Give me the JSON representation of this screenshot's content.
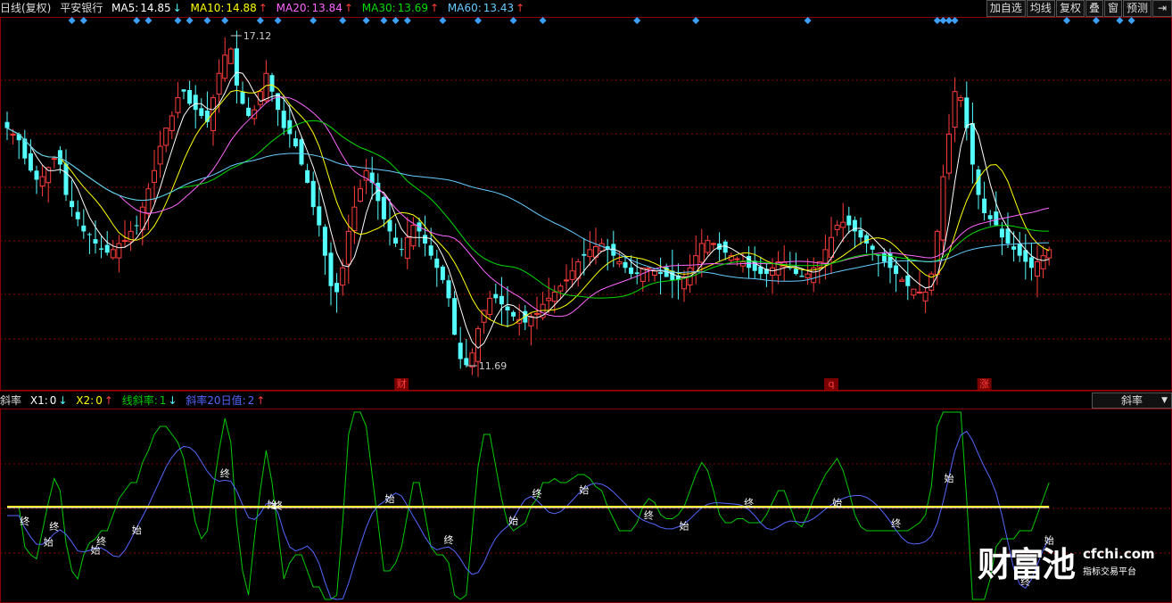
{
  "header": {
    "period": "日线(复权)",
    "stock_name": "平安银行",
    "ma5": {
      "label": "MA5:",
      "value": "14.85",
      "arrow": "↓",
      "color": "#ffffff"
    },
    "ma10": {
      "label": "MA10:",
      "value": "14.88",
      "arrow": "↑",
      "color": "#ffff00"
    },
    "ma20": {
      "label": "MA20:",
      "value": "13.84",
      "arrow": "↑",
      "color": "#ff66ff"
    },
    "ma30": {
      "label": "MA30:",
      "value": "13.69",
      "arrow": "↑",
      "color": "#00dd00"
    },
    "ma60": {
      "label": "MA60:",
      "value": "13.43",
      "arrow": "↑",
      "color": "#66ccff"
    }
  },
  "toolbar": {
    "add_watchlist": "加自选",
    "ma_lines": "均线",
    "adjust": "复权",
    "overlay": "叠",
    "window": "窗",
    "forecast": "预测",
    "expand_icon": "expand-right-icon"
  },
  "annotations": {
    "high_label": "17.12",
    "low_label": "11.69",
    "event_markers": [
      {
        "text": "财",
        "idx": 67
      },
      {
        "text": "q",
        "idx": 140
      },
      {
        "text": "涨",
        "idx": 166
      }
    ]
  },
  "indicator": {
    "name": "斜率",
    "x1": {
      "label": "X1:",
      "value": "0",
      "arrow": "↓",
      "color": "#ffffff"
    },
    "x2": {
      "label": "X2:",
      "value": "0",
      "arrow": "↑",
      "color": "#ffff00"
    },
    "slope": {
      "label": "线斜率:",
      "value": "1",
      "arrow": "↓",
      "color": "#00cc00"
    },
    "slope20": {
      "label": "斜率20日值:",
      "value": "2",
      "arrow": "↑",
      "color": "#5566ff"
    },
    "selector_label": "斜率",
    "start_word": "始",
    "end_word": "终",
    "signals": [
      {
        "type": "end",
        "idx": 3
      },
      {
        "type": "end",
        "idx": 8
      },
      {
        "type": "start",
        "idx": 7
      },
      {
        "type": "start",
        "idx": 15
      },
      {
        "type": "end",
        "idx": 16
      },
      {
        "type": "start",
        "idx": 22
      },
      {
        "type": "end",
        "idx": 37
      },
      {
        "type": "start",
        "idx": 45
      },
      {
        "type": "end",
        "idx": 46
      },
      {
        "type": "start",
        "idx": 65
      },
      {
        "type": "end",
        "idx": 75
      },
      {
        "type": "start",
        "idx": 86
      },
      {
        "type": "end",
        "idx": 90
      },
      {
        "type": "start",
        "idx": 98
      },
      {
        "type": "end",
        "idx": 109
      },
      {
        "type": "start",
        "idx": 115
      },
      {
        "type": "end",
        "idx": 126
      },
      {
        "type": "start",
        "idx": 141
      },
      {
        "type": "end",
        "idx": 151
      },
      {
        "type": "start",
        "idx": 160
      },
      {
        "type": "end",
        "idx": 173
      },
      {
        "type": "start",
        "idx": 185
      }
    ]
  },
  "colors": {
    "up": "#ff3c3c",
    "down": "#54ffff",
    "grid": "#8b0000",
    "diamond": "#3ca0ff"
  },
  "watermark": {
    "brand": "财富池",
    "domain": "cfchi.com",
    "slogan": "指标交易平台"
  },
  "chart_data": {
    "type": "candlestick",
    "close_series": [
      15.6,
      15.5,
      15.4,
      15.1,
      14.9,
      14.75,
      14.8,
      14.95,
      15.1,
      15.0,
      14.5,
      14.3,
      14.1,
      13.9,
      13.85,
      13.7,
      13.6,
      13.55,
      13.6,
      13.7,
      13.75,
      13.9,
      14.0,
      14.3,
      14.6,
      14.9,
      15.3,
      15.6,
      15.8,
      16.1,
      16.2,
      16.0,
      15.9,
      15.8,
      15.7,
      16.1,
      16.5,
      16.8,
      16.9,
      16.3,
      16.0,
      15.8,
      15.9,
      16.2,
      16.5,
      16.2,
      15.9,
      15.6,
      15.5,
      15.3,
      15.0,
      14.7,
      14.3,
      14.0,
      13.5,
      13.0,
      12.9,
      13.3,
      13.9,
      14.3,
      14.6,
      14.9,
      14.7,
      14.4,
      14.1,
      13.9,
      13.7,
      13.6,
      13.8,
      14.0,
      13.9,
      13.7,
      13.5,
      13.3,
      13.1,
      12.8,
      12.2,
      11.8,
      11.7,
      11.9,
      12.3,
      12.6,
      12.8,
      12.8,
      12.7,
      12.6,
      12.5,
      12.45,
      12.4,
      12.5,
      12.55,
      12.7,
      12.8,
      12.9,
      13.0,
      13.1,
      13.25,
      13.4,
      13.5,
      13.6,
      13.65,
      13.7,
      13.6,
      13.5,
      13.4,
      13.3,
      13.2,
      13.2,
      13.3,
      13.3,
      13.25,
      13.2,
      13.15,
      13.1,
      13.1,
      13.15,
      13.3,
      13.5,
      13.7,
      13.75,
      13.7,
      13.6,
      13.55,
      13.5,
      13.45,
      13.4,
      13.3,
      13.25,
      13.2,
      13.2,
      13.3,
      13.4,
      13.4,
      13.3,
      13.2,
      13.15,
      13.2,
      13.3,
      13.4,
      13.6,
      13.8,
      14.0,
      14.05,
      14.0,
      13.9,
      13.8,
      13.7,
      13.6,
      13.5,
      13.4,
      13.3,
      13.2,
      13.1,
      13.0,
      12.95,
      12.9,
      12.9,
      13.2,
      13.9,
      14.8,
      15.5,
      16.2,
      16.1,
      15.6,
      15.0,
      14.5,
      14.2,
      14.1,
      14.0,
      13.8,
      13.7,
      13.6,
      13.5,
      13.4,
      13.3,
      13.4,
      13.5,
      13.6
    ],
    "high_price": 17.12,
    "low_price": 11.69,
    "moving_averages": [
      "MA5",
      "MA10",
      "MA20",
      "MA30",
      "MA60"
    ],
    "indicator_type": "slope"
  }
}
